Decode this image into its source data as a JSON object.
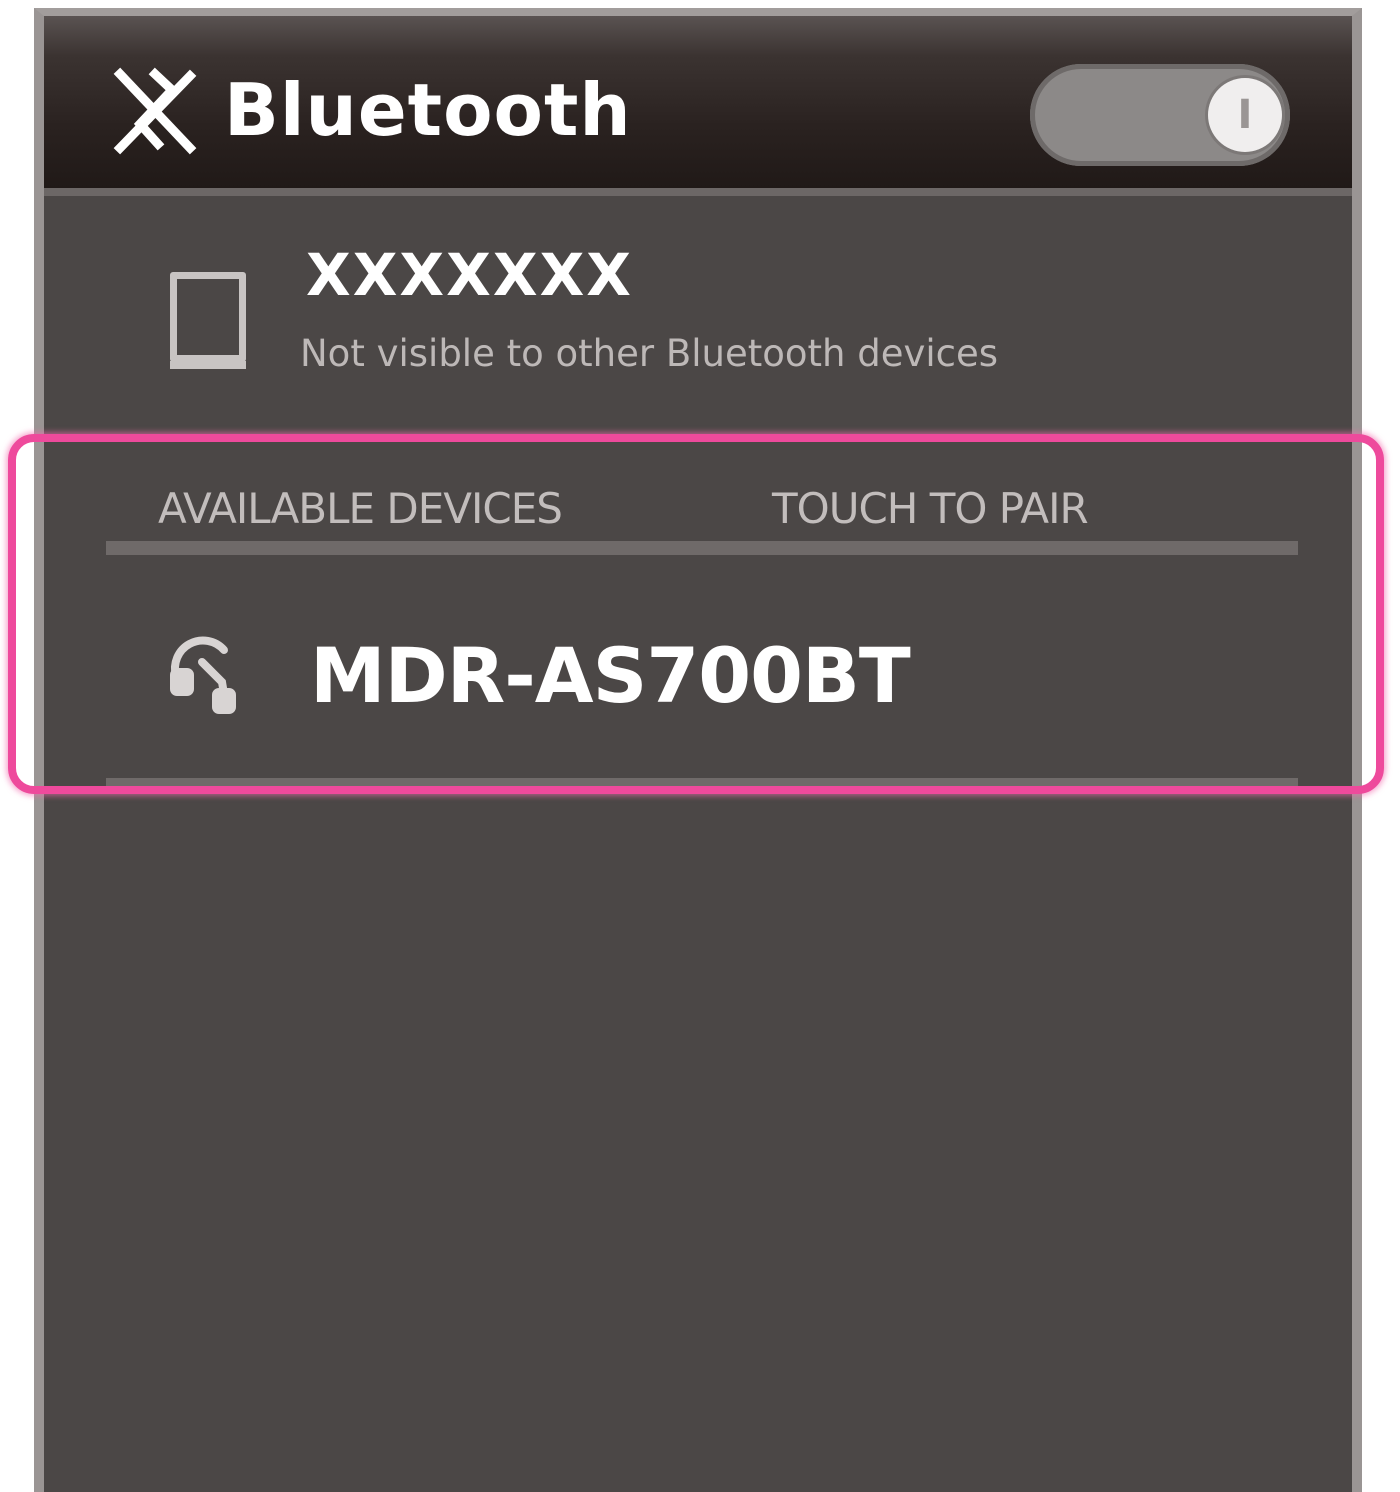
{
  "header": {
    "title": "Bluetooth",
    "icon": "bluetooth-icon",
    "toggle": {
      "state": "on",
      "knob_label": "I"
    }
  },
  "this_device": {
    "name": "XXXXXXX",
    "status": "Not visible to other Bluetooth devices",
    "icon": "phone-icon"
  },
  "available_section": {
    "heading": "AVAILABLE DEVICES",
    "hint": "TOUCH TO PAIR"
  },
  "available_devices": [
    {
      "name": "MDR-AS700BT",
      "icon": "headphones-icon"
    }
  ],
  "colors": {
    "highlight": "#ee4a9c",
    "panel": "#4b4746",
    "header": "#2a2220",
    "text": "#ffffff"
  }
}
